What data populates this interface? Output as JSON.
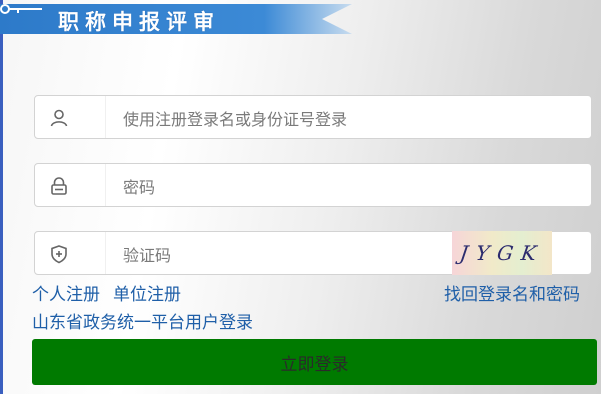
{
  "banner": {
    "title": "职称申报评审"
  },
  "form": {
    "username": {
      "placeholder": "使用注册登录名或身份证号登录",
      "icon": "user-icon"
    },
    "password": {
      "placeholder": "密码",
      "icon": "lock-icon"
    },
    "captcha": {
      "placeholder": "验证码",
      "icon": "shield-plus-icon",
      "code": "JYGK"
    }
  },
  "links": {
    "personal_register": "个人注册",
    "unit_register": "单位注册",
    "recover": "找回登录名和密码",
    "gov_login": "山东省政务统一平台用户登录"
  },
  "login_button": "立即登录",
  "colors": {
    "banner": "#2f7fd0",
    "link": "#1f5fa8",
    "button": "#007a00"
  }
}
